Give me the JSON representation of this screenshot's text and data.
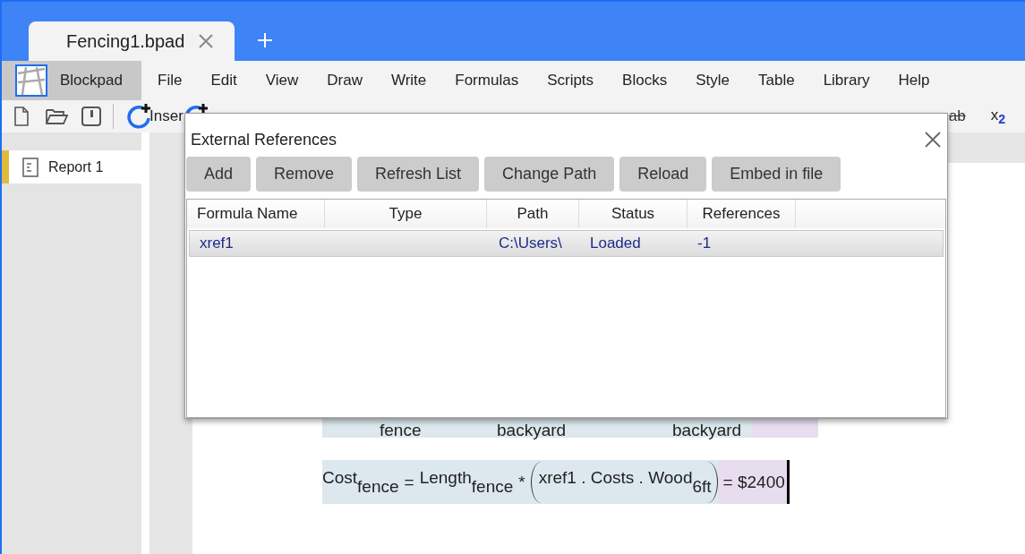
{
  "tabs": [
    {
      "label": "Fencing1.bpad",
      "selected": true
    }
  ],
  "menu": [
    {
      "label": "Blockpad",
      "kind": "app"
    },
    {
      "label": "File",
      "kind": "item"
    },
    {
      "label": "Edit",
      "kind": "item"
    },
    {
      "label": "View",
      "kind": "item"
    },
    {
      "label": "Draw",
      "kind": "item"
    },
    {
      "label": "Write",
      "kind": "item"
    },
    {
      "label": "Formulas",
      "kind": "item"
    },
    {
      "label": "Scripts",
      "kind": "item"
    },
    {
      "label": "Blocks",
      "kind": "item"
    },
    {
      "label": "Style",
      "kind": "item"
    },
    {
      "label": "Table",
      "kind": "item"
    },
    {
      "label": "Library",
      "kind": "item"
    },
    {
      "label": "Help",
      "kind": "item"
    }
  ],
  "toolbar": {
    "insert_label": "Inser",
    "format_buttons": [
      {
        "kind": "strike",
        "text": "ab"
      },
      {
        "kind": "subscript",
        "text": "x",
        "sub": "2"
      }
    ]
  },
  "sidebar": {
    "items": [
      {
        "label": "Report 1",
        "selected": true
      }
    ]
  },
  "document": {
    "rows": [
      {
        "kind": "partial",
        "subs": [
          "fence",
          "backyard",
          "backyard"
        ]
      },
      {
        "kind": "formula",
        "cursor": true,
        "tokens": [
          {
            "kind": "var",
            "name": "Cost",
            "sub": "fence"
          },
          {
            "kind": "op",
            "text": "="
          },
          {
            "kind": "var",
            "name": "Length",
            "sub": "fence"
          },
          {
            "kind": "op",
            "text": "*"
          },
          {
            "kind": "group",
            "children": [
              {
                "kind": "var",
                "name": "xref1 . Costs . Wood",
                "sub": "6ft"
              }
            ]
          },
          {
            "kind": "result",
            "text": "= $2400"
          }
        ]
      }
    ]
  },
  "dialog": {
    "title": "External References",
    "buttons": [
      "Add",
      "Remove",
      "Refresh List",
      "Change Path",
      "Reload",
      "Embed in file"
    ],
    "table": {
      "columns": [
        "Formula Name",
        "Type",
        "Path",
        "Status",
        "References"
      ],
      "rows": [
        {
          "selected": true,
          "cells": [
            "xref1",
            "",
            "C:\\Users\\",
            "Loaded",
            "-1"
          ]
        }
      ]
    }
  }
}
